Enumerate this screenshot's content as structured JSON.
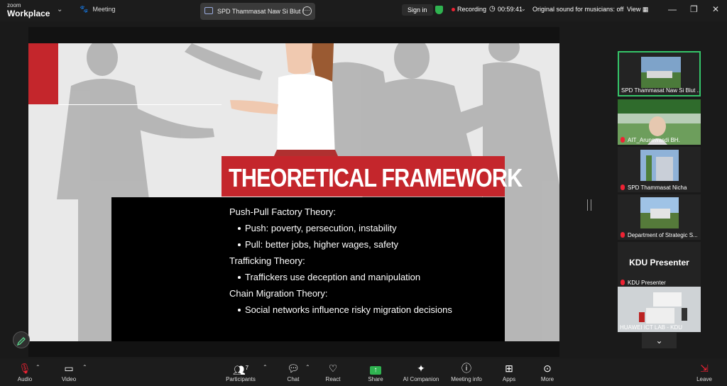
{
  "app": {
    "brand_small": "zoom",
    "brand_big": "Workplace"
  },
  "tabs": {
    "meeting": "Meeting",
    "share": "SPD Thammasat Naw Si Blut Moc"
  },
  "status": {
    "sign_in": "Sign in",
    "recording": "Recording",
    "timer": "00:59:41",
    "original_sound": "Original sound for musicians: off",
    "view": "View"
  },
  "colors": {
    "accent_red": "#c4262c",
    "active_border": "#35c569",
    "recording": "#ee2233"
  },
  "slide": {
    "title": "THEORETICAL FRAMEWORK",
    "lines": [
      "Push-Pull Factory Theory:",
      "Push: poverty, persecution, instability",
      "Pull: better jobs, higher wages, safety",
      "Trafficking Theory:",
      "Traffickers use deception and manipulation",
      "Chain Migration Theory:",
      "Social networks influence risky migration decisions"
    ]
  },
  "participants": [
    {
      "name": "SPD Thammasat Naw Si Blut ...",
      "muted": false,
      "active": true
    },
    {
      "name": "AIT_Arunswasdi BH.",
      "muted": true,
      "active": false
    },
    {
      "name": "SPD Thammasat Nicha",
      "muted": true,
      "active": false
    },
    {
      "name": "Department of Strategic S...",
      "muted": true,
      "active": false
    },
    {
      "name": "KDU Presenter",
      "label": "KDU Presenter",
      "muted": true,
      "active": false
    },
    {
      "name": "HUAWEI ICT LAB - KDU",
      "muted": false,
      "active": false
    }
  ],
  "toolbar": {
    "audio": "Audio",
    "video": "Video",
    "participants": "Participants",
    "participants_count": "7",
    "chat": "Chat",
    "react": "React",
    "share": "Share",
    "ai_companion": "AI Companion",
    "meeting_info": "Meeting info",
    "apps": "Apps",
    "more": "More",
    "leave": "Leave"
  },
  "icons": [
    "paw-icon",
    "shield-icon",
    "clock-icon",
    "mic-muted-icon",
    "camera-icon",
    "people-icon",
    "chat-icon",
    "heart-icon",
    "share-arrow-icon",
    "sparkle-icon",
    "info-icon",
    "apps-icon",
    "more-icon",
    "leave-icon",
    "pen-icon",
    "chevron-down-icon"
  ]
}
